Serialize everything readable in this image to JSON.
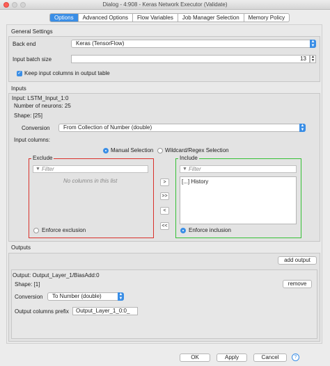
{
  "window": {
    "title": "Dialog - 4:908 - Keras Network Executor (Validate)"
  },
  "tabs": [
    "Options",
    "Advanced Options",
    "Flow Variables",
    "Job Manager Selection",
    "Memory Policy"
  ],
  "general": {
    "legend": "General Settings",
    "backend_label": "Back end",
    "backend_value": "Keras (TensorFlow)",
    "batch_label": "Input batch size",
    "batch_value": "13",
    "keep_columns_label": "Keep input columns in output table"
  },
  "inputs": {
    "legend": "Inputs",
    "input_name": "Input: LSTM_Input_1:0",
    "neurons": "Number of neurons: 25",
    "shape": "Shape: [25]",
    "conversion_label": "Conversion",
    "conversion_value": "From Collection of Number (double)",
    "input_columns_label": "Input columns:",
    "manual_selection": "Manual Selection",
    "wildcard_selection": "Wildcard/Regex Selection",
    "exclude": {
      "title": "Exclude",
      "filter_placeholder": "Filter",
      "empty_text": "No columns in this list",
      "enforce": "Enforce exclusion"
    },
    "include": {
      "title": "Include",
      "filter_placeholder": "Filter",
      "item": "History",
      "item_icon": "[...]",
      "enforce": "Enforce inclusion"
    },
    "move_buttons": [
      ">",
      ">>",
      "<",
      "<<"
    ]
  },
  "outputs": {
    "legend": "Outputs",
    "add_output": "add output",
    "output_name": "Output: Output_Layer_1/BiasAdd:0",
    "shape": "Shape: [1]",
    "remove": "remove",
    "conversion_label": "Conversion",
    "conversion_value": "To Number (double)",
    "prefix_label": "Output columns prefix",
    "prefix_value": "Output_Layer_1_0:0_"
  },
  "footer": {
    "ok": "OK",
    "apply": "Apply",
    "cancel": "Cancel",
    "help": "?"
  },
  "colors": {
    "accent": "#3a8ee6",
    "exclude_border": "#d9302a",
    "include_border": "#35c035"
  }
}
